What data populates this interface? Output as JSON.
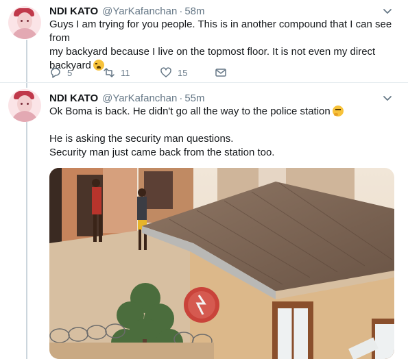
{
  "tweets": [
    {
      "name": "NDI KATO",
      "handle": "@YarKafanchan",
      "separator": "·",
      "time": "58m",
      "lines": [
        "Guys I am trying for you people. This is in another compound that I can see from",
        "my backyard because I live on the topmost floor. It is not even my direct",
        "backyard"
      ],
      "replies": "5",
      "retweets": "11",
      "likes": "15"
    },
    {
      "name": "NDI KATO",
      "handle": "@YarKafanchan",
      "separator": "·",
      "time": "55m",
      "line1": "Ok Boma is back. He didn't go all the way to the police station",
      "line2": "He is asking the security man questions.",
      "line3": "Security man just came back from the station too."
    }
  ],
  "icons": {
    "reply": "reply-icon",
    "retweet": "retweet-icon",
    "like": "heart-icon",
    "dm": "envelope-icon",
    "caret": "chevron-down-icon"
  },
  "colors": {
    "text": "#14171a",
    "secondary": "#657786",
    "divider": "#e6ecf0",
    "thread": "#ccd6dd"
  }
}
